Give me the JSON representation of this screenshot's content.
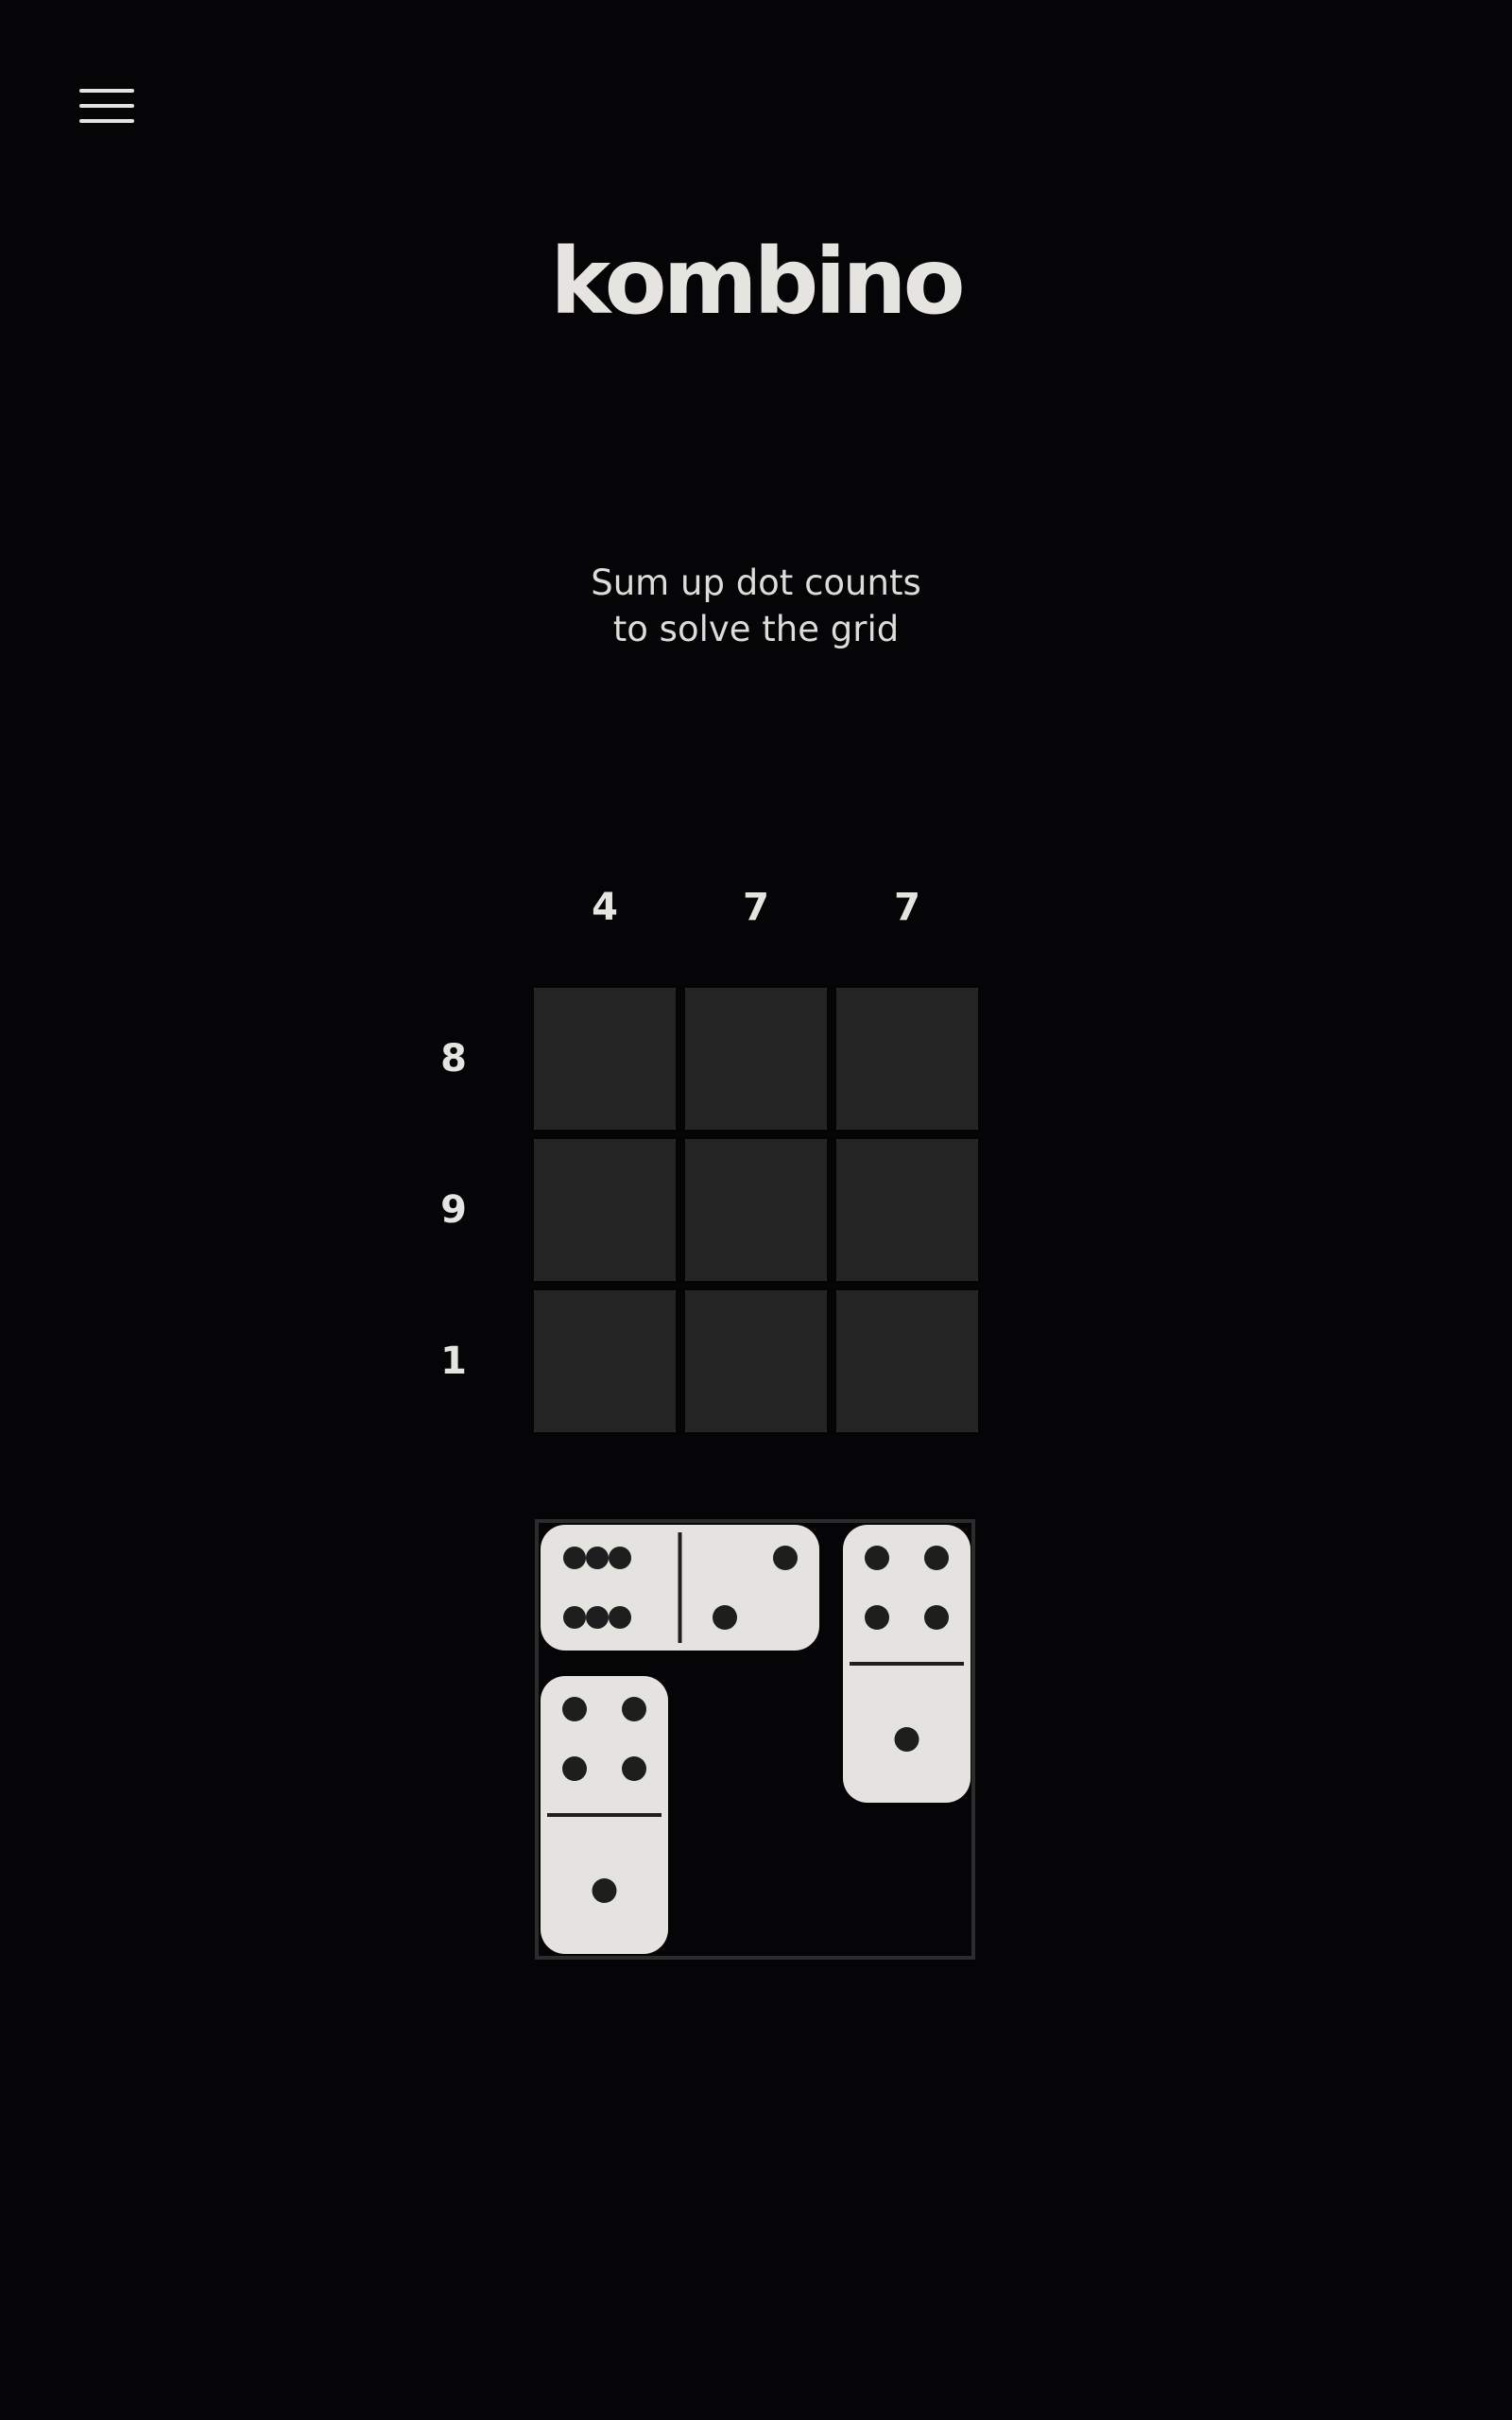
{
  "header": {
    "menu_icon": "hamburger-menu-icon",
    "title": "kombino",
    "subtitle_line1": "Sum up dot counts",
    "subtitle_line2": "to solve the grid"
  },
  "puzzle": {
    "column_clues": [
      "4",
      "7",
      "7"
    ],
    "row_clues": [
      "8",
      "9",
      "1"
    ],
    "grid_rows": 3,
    "grid_cols": 3,
    "cells_filled": []
  },
  "colors": {
    "background": "#050507",
    "cell": "#252525",
    "domino_face": "#e4e3e0",
    "pip": "#1e1e1e",
    "text": "#e6e4e0"
  },
  "tray": {
    "dominoes": [
      {
        "orientation": "horizontal",
        "ends": [
          6,
          2
        ]
      },
      {
        "orientation": "vertical",
        "ends": [
          4,
          1
        ]
      },
      {
        "orientation": "vertical",
        "ends": [
          4,
          1
        ]
      }
    ]
  }
}
